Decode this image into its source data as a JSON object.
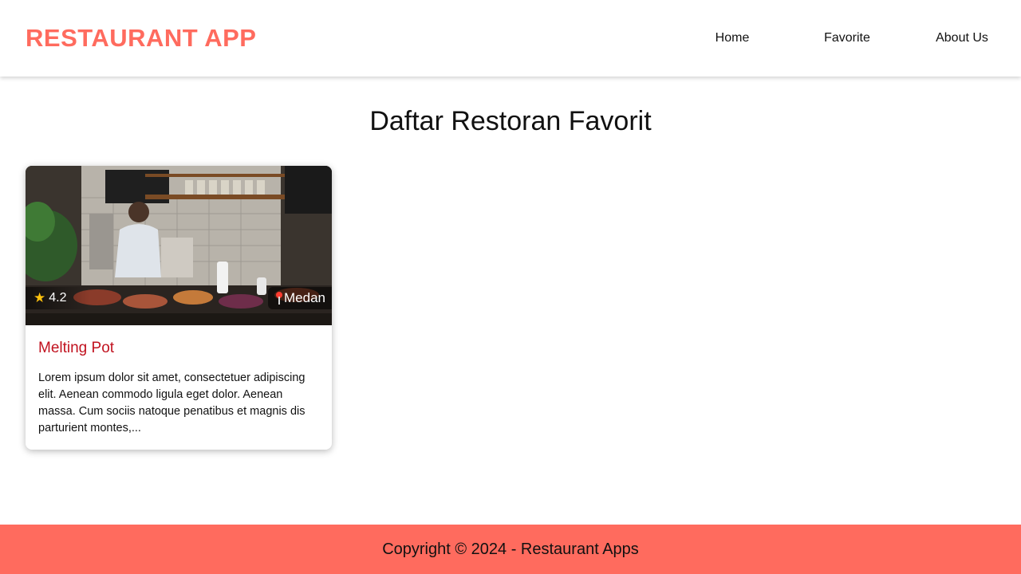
{
  "header": {
    "logo": "RESTAURANT APP",
    "nav": [
      {
        "label": "Home"
      },
      {
        "label": "Favorite"
      },
      {
        "label": "About Us"
      }
    ]
  },
  "main": {
    "title": "Daftar Restoran Favorit",
    "restaurants": [
      {
        "name": "Melting Pot",
        "rating": "4.2",
        "city": "Medan",
        "description": "Lorem ipsum dolor sit amet, consectetuer adipiscing elit. Aenean commodo ligula eget dolor. Aenean massa. Cum sociis natoque penatibus et magnis dis parturient montes,...",
        "image_alt": "cafe-counter-photo"
      }
    ]
  },
  "footer": {
    "copyright": "Copyright © 2024 - Restaurant Apps"
  },
  "colors": {
    "brand": "#ff6b5e",
    "restaurant_name": "#c1121f",
    "star": "#ffc20e",
    "pin": "#ff3b2f"
  },
  "icons": [
    "star-icon",
    "location-pin-icon"
  ]
}
